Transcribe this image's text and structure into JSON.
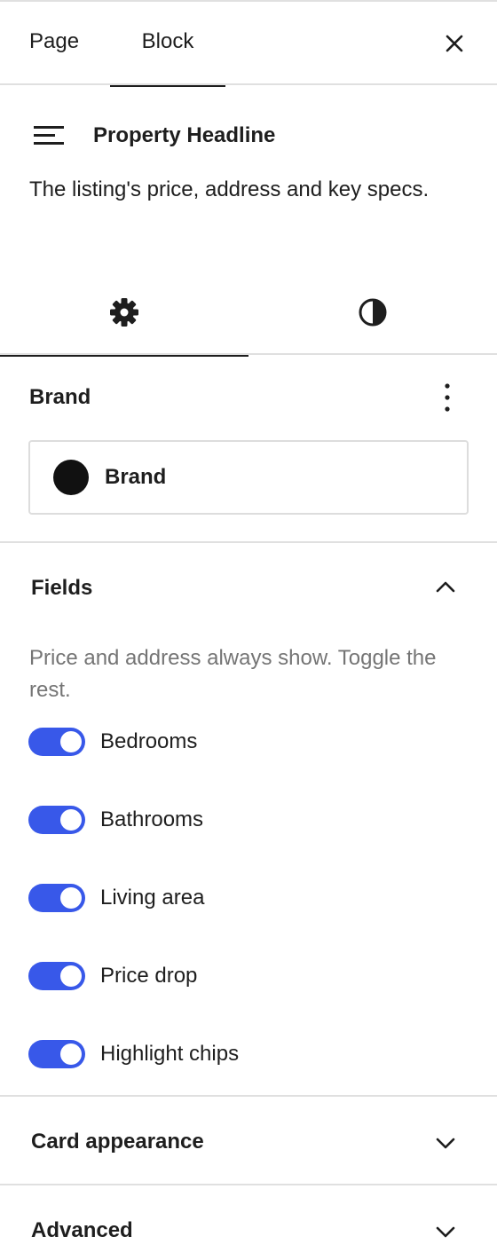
{
  "header": {
    "tab_page": "Page",
    "tab_block": "Block"
  },
  "block_card": {
    "title": "Property Headline",
    "description": "The listing's price, address and key specs."
  },
  "brand_panel": {
    "title": "Brand",
    "selected_label": "Brand",
    "swatch_color": "#111111"
  },
  "fields_panel": {
    "title": "Fields",
    "expanded": true,
    "help": "Price and address always show. Toggle the rest.",
    "toggles": [
      {
        "label": "Bedrooms",
        "checked": true
      },
      {
        "label": "Bathrooms",
        "checked": true
      },
      {
        "label": "Living area",
        "checked": true
      },
      {
        "label": "Price drop",
        "checked": true
      },
      {
        "label": "Highlight chips",
        "checked": true
      }
    ]
  },
  "card_appearance_panel": {
    "title": "Card appearance",
    "expanded": false
  },
  "advanced_panel": {
    "title": "Advanced",
    "expanded": false
  },
  "colors": {
    "accent": "#3858e9",
    "border": "#e0e0e0",
    "text": "#1e1e1e",
    "muted": "#757575"
  }
}
